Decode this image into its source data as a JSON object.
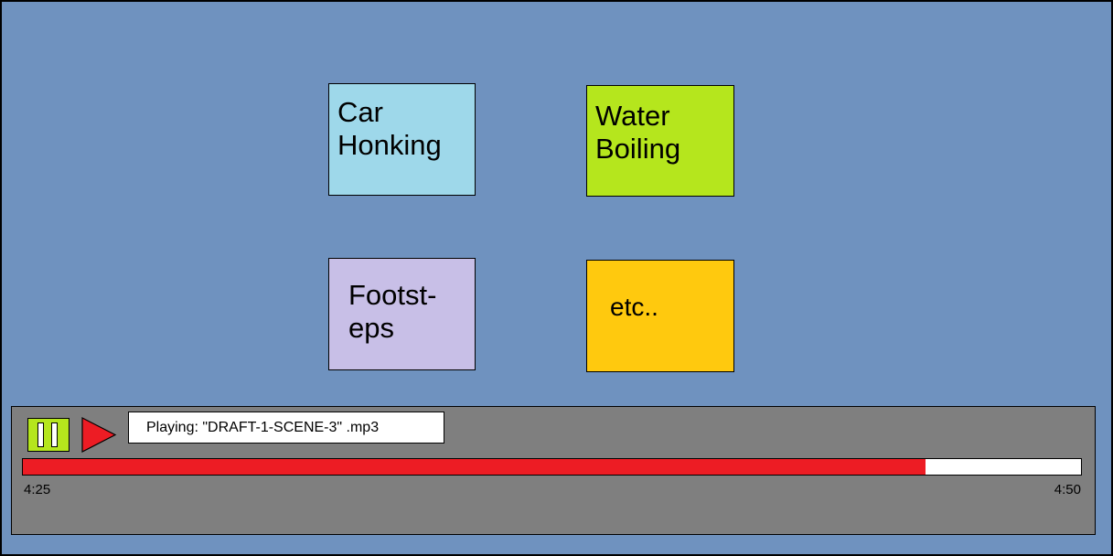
{
  "sound_tiles": [
    {
      "label": "Car\nHonking",
      "color": "#9ed8ea"
    },
    {
      "label": "Water\nBoiling",
      "color": "#b5e61d"
    },
    {
      "label": "Footst-\neps",
      "color": "#c8bfe7"
    },
    {
      "label": "etc..",
      "color": "#ffc90e"
    }
  ],
  "player": {
    "pause_icon": "pause-icon",
    "play_icon": "play-icon",
    "now_playing": "Playing: \"DRAFT-1-SCENE-3\" .mp3",
    "current_time": "4:25",
    "total_time": "4:50",
    "progress": 0.853,
    "progress_color": "#ed1c24",
    "background_color": "#7f7f7f"
  },
  "colors": {
    "background": "#6f92bf",
    "pause_button": "#b5e61d",
    "play_button": "#ed1c24"
  }
}
